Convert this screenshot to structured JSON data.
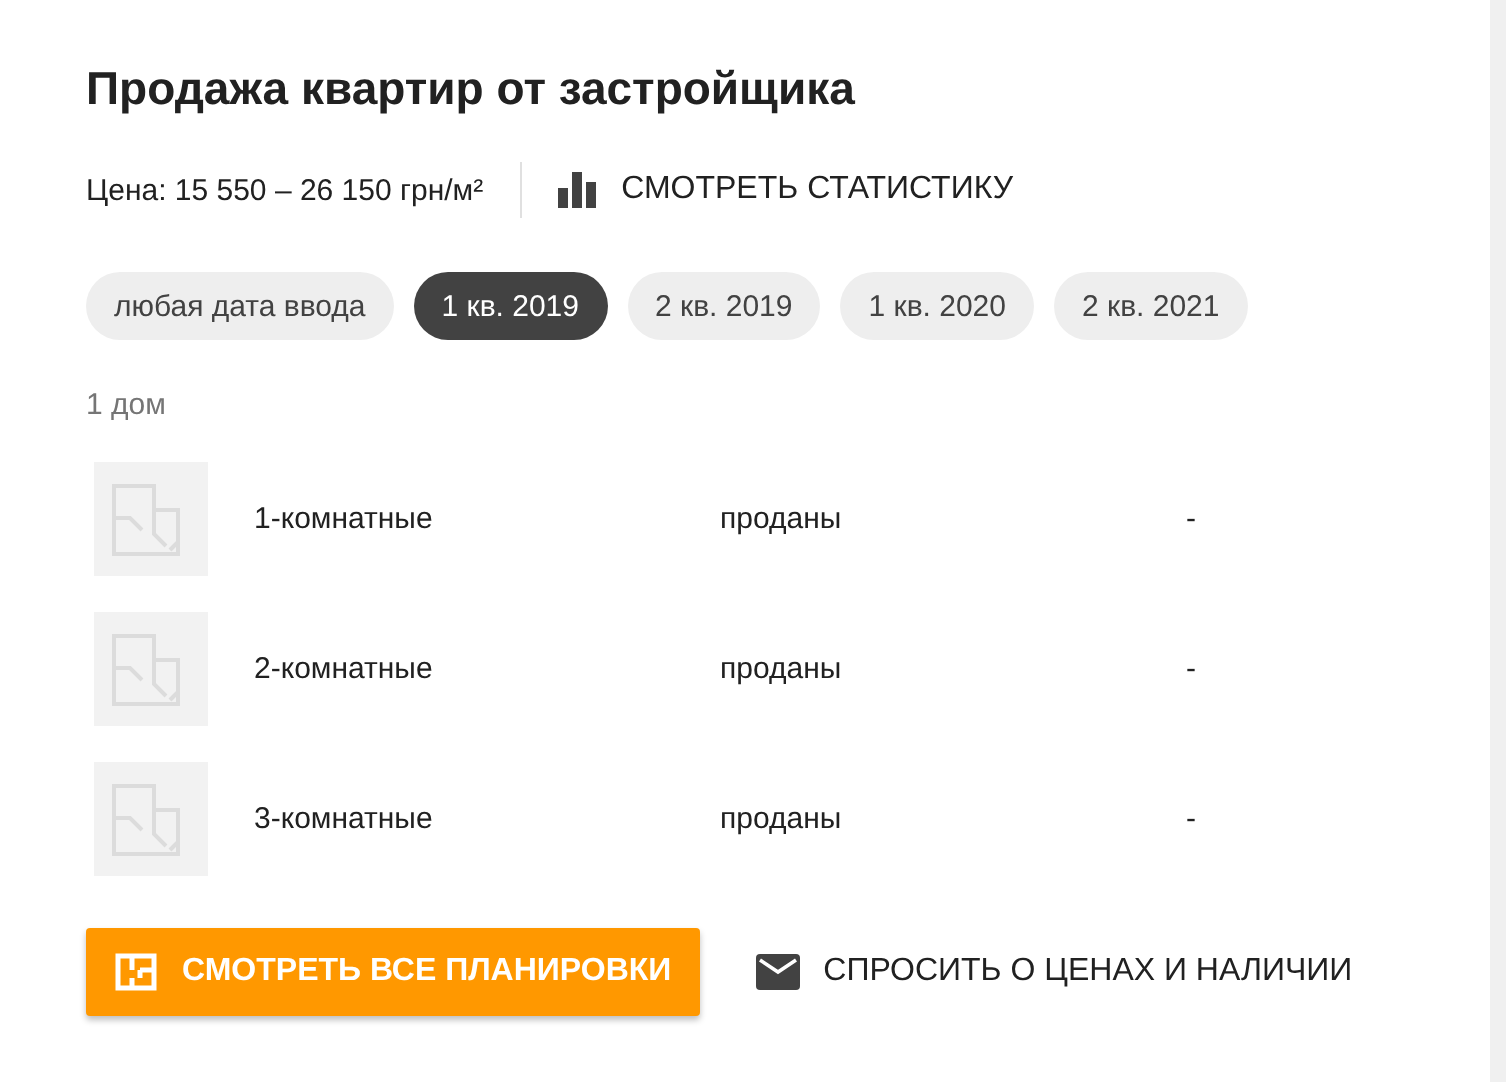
{
  "title": "Продажа квартир от застройщика",
  "price": "Цена: 15 550 – 26 150 грн/м²",
  "stats_link": "СМОТРЕТЬ СТАТИСТИКУ",
  "filters": [
    {
      "label": "любая дата ввода",
      "selected": false
    },
    {
      "label": "1 кв. 2019",
      "selected": true
    },
    {
      "label": "2 кв. 2019",
      "selected": false
    },
    {
      "label": "1 кв. 2020",
      "selected": false
    },
    {
      "label": "2 кв. 2021",
      "selected": false
    }
  ],
  "house_count": "1 дом",
  "rows": [
    {
      "rooms": "1-комнатные",
      "status": "проданы",
      "price": "-"
    },
    {
      "rooms": "2-комнатные",
      "status": "проданы",
      "price": "-"
    },
    {
      "rooms": "3-комнатные",
      "status": "проданы",
      "price": "-"
    }
  ],
  "buttons": {
    "plans": "СМОТРЕТЬ ВСЕ ПЛАНИРОВКИ",
    "ask": "СПРОСИТЬ О ЦЕНАХ И НАЛИЧИИ"
  }
}
